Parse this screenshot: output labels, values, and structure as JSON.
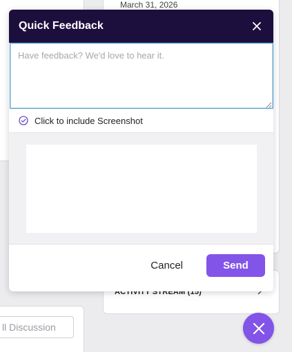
{
  "background": {
    "date": "March 31, 2026",
    "activity_stream_label": "ACTIVITY STREAM (15)",
    "discussion_input_text": "ll Discussion"
  },
  "modal": {
    "title": "Quick Feedback",
    "feedback_placeholder": "Have feedback? We'd love to hear it.",
    "feedback_value": "",
    "screenshot_toggle_label": "Click to include Screenshot",
    "cancel_label": "Cancel",
    "send_label": "Send"
  },
  "icons": {
    "close": "close-icon",
    "check": "check-circle-icon",
    "chevron": "chevron-right-icon",
    "fab": "close-icon"
  },
  "colors": {
    "header_bg": "#1d0f3d",
    "accent": "#8354e8",
    "focus_border": "#5ba3d6"
  }
}
